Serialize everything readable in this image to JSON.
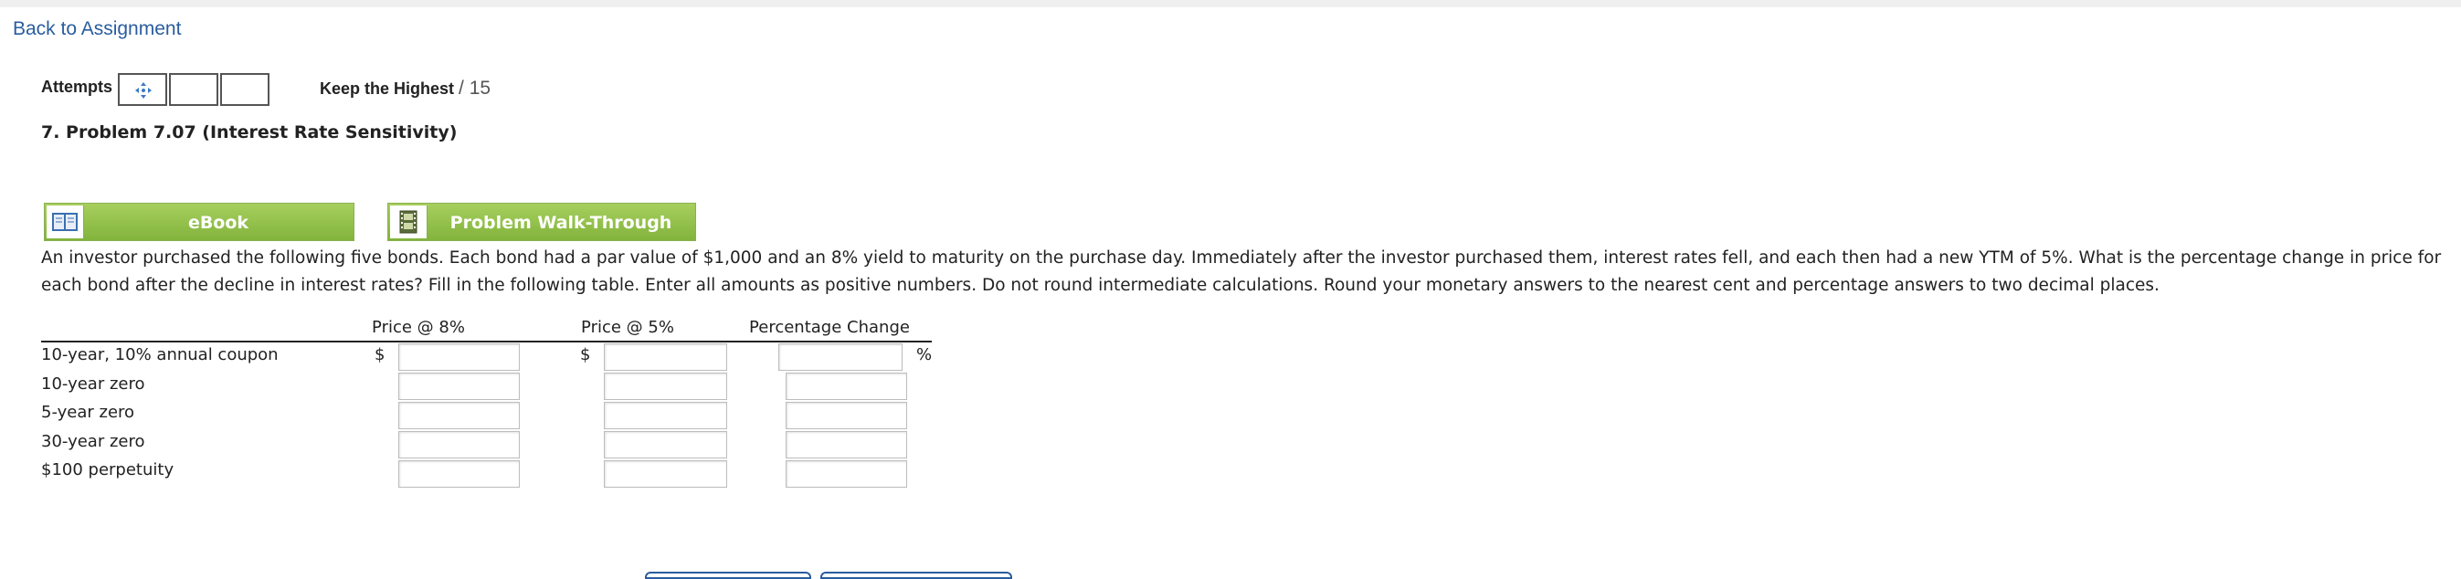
{
  "nav": {
    "back_label": "Back to Assignment"
  },
  "attempts": {
    "label": "Attempts",
    "keep_label": "Keep the Highest",
    "score_label": "/ 15"
  },
  "problem": {
    "title": "7.  Problem 7.07 (Interest Rate Sensitivity)"
  },
  "tools": {
    "ebook_label": "eBook",
    "walkthrough_label": "Problem Walk-Through"
  },
  "instructions": "An investor purchased the following five bonds. Each bond had a par value of $1,000 and an 8% yield to maturity on the purchase day. Immediately after the investor purchased them, interest rates fell, and each then had a new YTM of 5%. What is the percentage change in price for each bond after the decline in interest rates? Fill in the following table. Enter all amounts as positive numbers. Do not round intermediate calculations. Round your monetary answers to the nearest cent and percentage answers to two decimal places.",
  "table": {
    "headers": [
      "Price @ 8%",
      "Price @ 5%",
      "Percentage Change"
    ],
    "currency_symbol": "$",
    "percent_symbol": "%",
    "rows": [
      {
        "label": "10-year, 10% annual coupon",
        "price8": "",
        "price5": "",
        "pct": ""
      },
      {
        "label": "10-year zero",
        "price8": "",
        "price5": "",
        "pct": ""
      },
      {
        "label": "5-year zero",
        "price8": "",
        "price5": "",
        "pct": ""
      },
      {
        "label": "30-year zero",
        "price8": "",
        "price5": "",
        "pct": ""
      },
      {
        "label": "$100 perpetuity",
        "price8": "",
        "price5": "",
        "pct": ""
      }
    ]
  },
  "colors": {
    "link": "#2a5d9f",
    "button_green": "#93c24b",
    "cell_border": "#bdbdbd"
  },
  "icons": {
    "attempt": "move-arrows-icon",
    "ebook": "book-icon",
    "walkthrough": "film-icon"
  }
}
